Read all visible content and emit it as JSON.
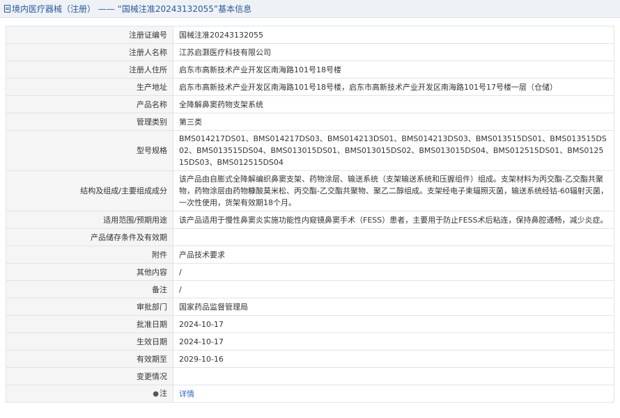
{
  "header": {
    "category": "境内医疗器械（注册）",
    "separator": " —— ",
    "quoted_title": "“国械注准20243132055”",
    "suffix": "基本信息"
  },
  "rows": [
    {
      "label": "注册证编号",
      "value": "国械注准20243132055"
    },
    {
      "label": "注册人名称",
      "value": "江苏启灏医疗科技有限公司"
    },
    {
      "label": "注册人住所",
      "value": "启东市高新技术产业开发区南海路101号18号楼"
    },
    {
      "label": "生产地址",
      "value": "启东市高新技术产业开发区南海路101号18号楼，启东市高新技术产业开发区南海路101号17号楼一层（仓储）"
    },
    {
      "label": "产品名称",
      "value": "全降解鼻窦药物支架系统"
    },
    {
      "label": "管理类别",
      "value": "第三类"
    },
    {
      "label": "型号规格",
      "value": "BMS014217DS01、BMS014217DS03、BMS014213DS01、BMS014213DS03、BMS013515DS01、BMS013515DS02、BMS013515DS04、BMS013015DS01、BMS013015DS02、BMS013015DS04、BMS012515DS01、BMS012515DS03、BMS012515DS04"
    },
    {
      "label": "结构及组成/主要组成成分",
      "value": "该产品由自膨式全降解编织鼻窦支架、药物涂层、输送系统（支架输送系统和压握组件）组成。支架材料为丙交酯-乙交酯共聚物，药物涂层由药物糠酸莫米松、丙交酯-乙交酯共聚物、聚乙二醇组成。支架经电子束辐照灭菌，输送系统经钴-60辐射灭菌，一次性使用，货架有效期18个月。"
    },
    {
      "label": "适用范围/预期用途",
      "value": "该产品适用于慢性鼻窦炎实施功能性内窥镜鼻窦手术（FESS）患者，主要用于防止FESS术后粘连，保持鼻腔通畅，减少炎症。"
    },
    {
      "label": "产品储存条件及有效期",
      "value": ""
    },
    {
      "label": "附件",
      "value": "产品技术要求"
    },
    {
      "label": "其他内容",
      "value": "/"
    },
    {
      "label": "备注",
      "value": "/"
    },
    {
      "label": "审批部门",
      "value": "国家药品监督管理局"
    },
    {
      "label": "批准日期",
      "value": "2024-10-17"
    },
    {
      "label": "生效日期",
      "value": "2024-10-17"
    },
    {
      "label": "有效期至",
      "value": "2029-10-16"
    },
    {
      "label": "变更情况",
      "value": ""
    }
  ],
  "note_row": {
    "label": "注",
    "icon": "pin-icon",
    "link_text": "详情"
  },
  "colors": {
    "link": "#3366bb",
    "header_text": "#2a5a9a",
    "label_bg": "#f5f5f5",
    "border": "#dfe3e8"
  }
}
